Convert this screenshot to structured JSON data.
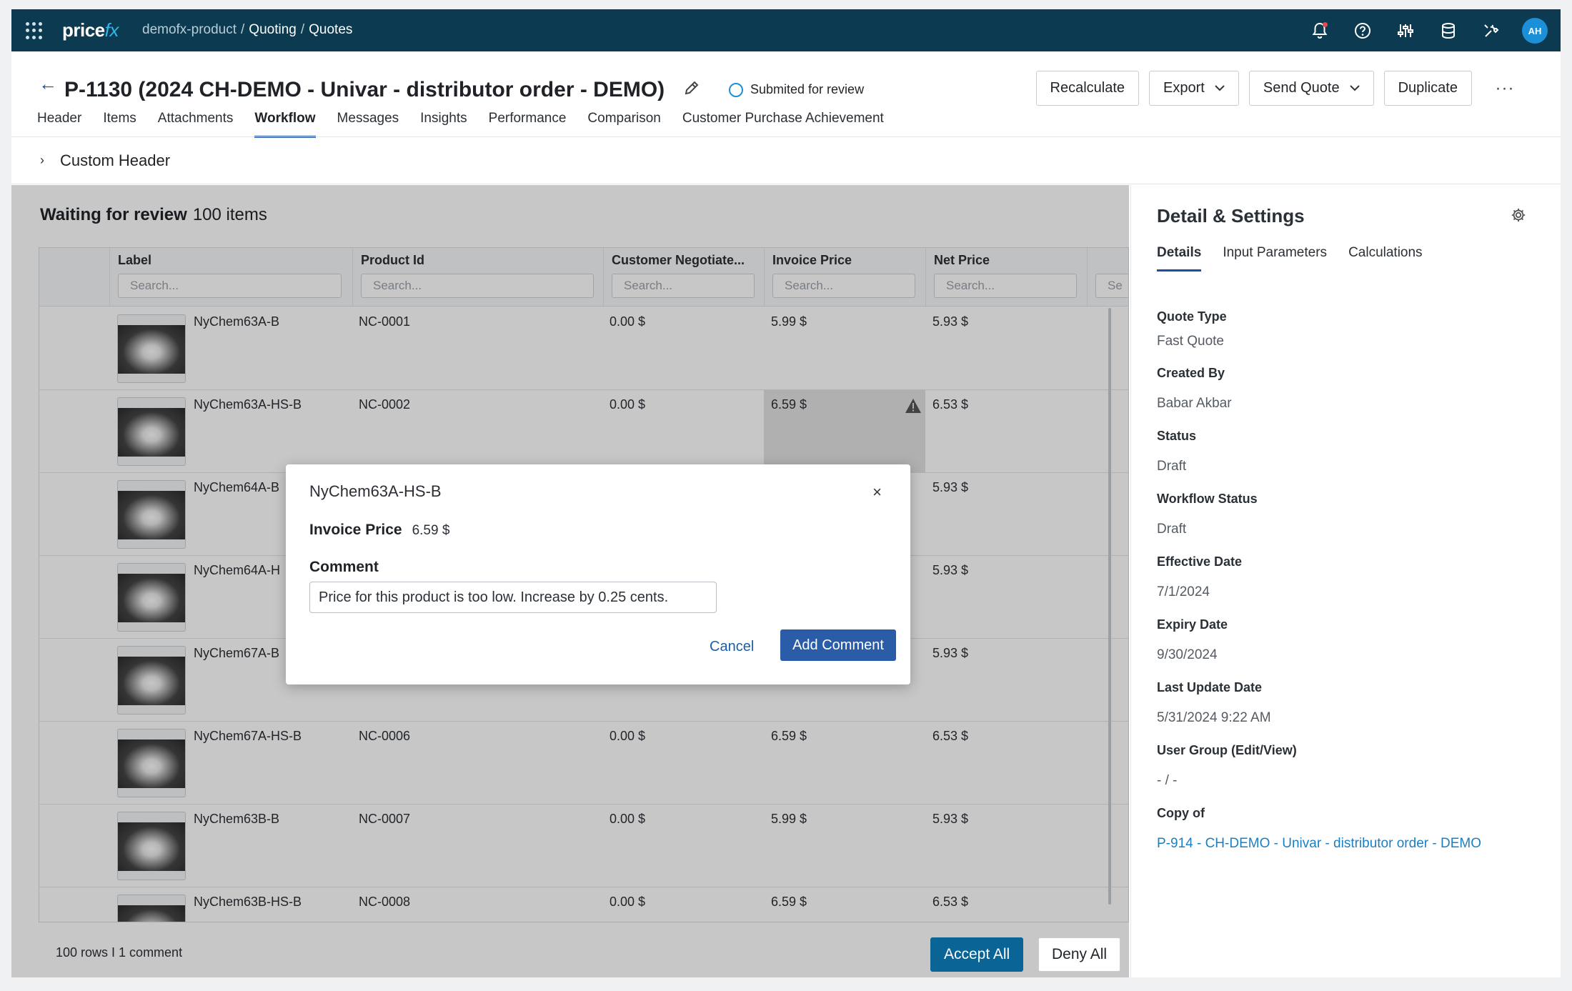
{
  "topbar": {
    "logo_main": "price",
    "logo_accent": "fx",
    "breadcrumb": [
      "demofx-product",
      "Quoting",
      "Quotes"
    ],
    "avatar_initials": "AH"
  },
  "quote": {
    "title": "P-1130 (2024 CH-DEMO - Univar - distributor order - DEMO)",
    "status": "Submited for review"
  },
  "actions": {
    "recalculate": "Recalculate",
    "export": "Export",
    "send_quote": "Send Quote",
    "duplicate": "Duplicate",
    "more": "···"
  },
  "tabs": [
    "Header",
    "Items",
    "Attachments",
    "Workflow",
    "Messages",
    "Insights",
    "Performance",
    "Comparison",
    "Customer Purchase Achievement"
  ],
  "active_tab": "Workflow",
  "custom_header": {
    "label": "Custom Header"
  },
  "review": {
    "title": "Waiting for review",
    "count": "100 items"
  },
  "grid": {
    "columns": [
      {
        "label": "Label",
        "placeholder": "Search..."
      },
      {
        "label": "Product Id",
        "placeholder": "Search..."
      },
      {
        "label": "Customer Negotiate...",
        "placeholder": "Search..."
      },
      {
        "label": "Invoice Price",
        "placeholder": "Search..."
      },
      {
        "label": "Net Price",
        "placeholder": "Search..."
      },
      {
        "label": "",
        "placeholder": "Se"
      }
    ],
    "rows": [
      {
        "label": "NyChem63A-B",
        "product_id": "NC-0001",
        "customer_negotiated": "0.00 $",
        "invoice_price": "5.99 $",
        "net_price": "5.93 $"
      },
      {
        "label": "NyChem63A-HS-B",
        "product_id": "NC-0002",
        "customer_negotiated": "0.00 $",
        "invoice_price": "6.59 $",
        "net_price": "6.53 $"
      },
      {
        "label": "NyChem64A-B",
        "product_id": "",
        "customer_negotiated": "",
        "invoice_price": "",
        "net_price": "5.93 $"
      },
      {
        "label": "NyChem64A-H",
        "product_id": "",
        "customer_negotiated": "",
        "invoice_price": "",
        "net_price": "5.93 $"
      },
      {
        "label": "NyChem67A-B",
        "product_id": "",
        "customer_negotiated": "",
        "invoice_price": "",
        "net_price": "5.93 $"
      },
      {
        "label": "NyChem67A-HS-B",
        "product_id": "NC-0006",
        "customer_negotiated": "0.00 $",
        "invoice_price": "6.59 $",
        "net_price": "6.53 $"
      },
      {
        "label": "NyChem63B-B",
        "product_id": "NC-0007",
        "customer_negotiated": "0.00 $",
        "invoice_price": "5.99 $",
        "net_price": "5.93 $"
      },
      {
        "label": "NyChem63B-HS-B",
        "product_id": "NC-0008",
        "customer_negotiated": "0.00 $",
        "invoice_price": "6.59 $",
        "net_price": "6.53 $"
      }
    ]
  },
  "footer": {
    "summary": "100 rows I 1 comment",
    "accept_all": "Accept All",
    "deny_all": "Deny All"
  },
  "modal": {
    "title": "NyChem63A-HS-B",
    "close": "×",
    "field_label": "Invoice Price",
    "field_value": "6.59 $",
    "comment_label": "Comment",
    "comment_value": "Price for this product is too low. Increase by 0.25 cents.",
    "cancel": "Cancel",
    "add_comment": "Add Comment"
  },
  "details": {
    "title": "Detail & Settings",
    "tabs": [
      "Details",
      "Input Parameters",
      "Calculations"
    ],
    "fields": [
      {
        "label": "Quote Type",
        "value": "Fast Quote"
      },
      {
        "label": "Created By",
        "value": "Babar Akbar"
      },
      {
        "label": "Status",
        "value": "Draft"
      },
      {
        "label": "Workflow Status",
        "value": "Draft"
      },
      {
        "label": "Effective Date",
        "value": "7/1/2024"
      },
      {
        "label": "Expiry Date",
        "value": "9/30/2024"
      },
      {
        "label": "Last Update Date",
        "value": "5/31/2024 9:22 AM"
      },
      {
        "label": "User Group (Edit/View)",
        "value": "- / -"
      },
      {
        "label": "Copy of",
        "value": "P-914 - CH-DEMO - Univar - distributor order - DEMO"
      }
    ]
  },
  "colors": {
    "topbar": "#0c3a50",
    "accent": "#1c4f9c",
    "primary_button": "#0a6496",
    "link": "#1c7fc2"
  }
}
